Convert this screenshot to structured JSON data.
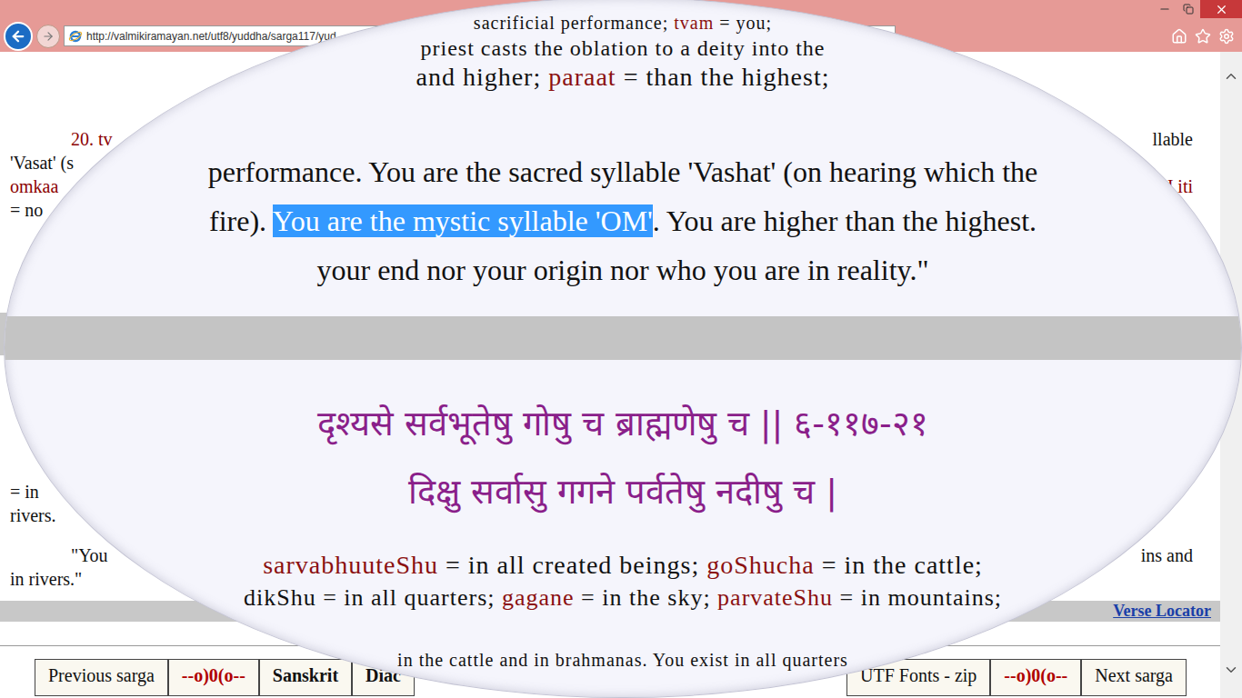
{
  "browser": {
    "url": "http://valmikiramayan.net/utf8/yuddha/sarga117/yud"
  },
  "page": {
    "upper_rows": [
      {
        "left": "20. tv",
        "left_kind": "term",
        "right": "llable",
        "right_kind": "plain",
        "paragraph_start": true
      },
      {
        "left": "'Vasat' (s",
        "left_kind": "plain",
        "right": "",
        "right_kind": "plain",
        "paragraph_start": false
      },
      {
        "left": "omkaa",
        "left_kind": "term",
        "right": "H iti",
        "right_kind": "term",
        "paragraph_start": false
      },
      {
        "left": "= no",
        "left_kind": "plain",
        "right": "",
        "right_kind": "plain",
        "paragraph_start": false
      }
    ],
    "lower_gloss_rows": [
      {
        "left": "= in",
        "left_kind": "plain",
        "right": "",
        "right_kind": "plain",
        "paragraph_start": false
      },
      {
        "left": "rivers.",
        "left_kind": "plain",
        "right": "",
        "right_kind": "plain",
        "paragraph_start": false
      }
    ],
    "lower_translation_rows": [
      {
        "left": "\"You",
        "left_kind": "plain",
        "right": "ins and",
        "right_kind": "plain",
        "paragraph_start": true
      },
      {
        "left": "in rivers.\"",
        "left_kind": "plain",
        "right": "",
        "right_kind": "plain",
        "paragraph_start": false
      }
    ],
    "verse_locator": "Verse Locator",
    "nav_left": [
      {
        "label": "Previous sarga",
        "kind": "link"
      },
      {
        "label": "--o)0(o--",
        "kind": "ornament"
      },
      {
        "label": "Sanskrit",
        "kind": "emphasis"
      },
      {
        "label": "Diac",
        "kind": "emphasis"
      }
    ],
    "nav_right": [
      {
        "label": "UTF Fonts - zip",
        "kind": "link"
      },
      {
        "label": "--o)0(o--",
        "kind": "ornament"
      },
      {
        "label": "Next sarga",
        "kind": "link"
      }
    ]
  },
  "magnifier": {
    "top": [
      [
        {
          "text": "sacrificial performance; ",
          "kind": "plain"
        },
        {
          "text": "tvam",
          "kind": "term"
        },
        {
          "text": " = you;",
          "kind": "plain"
        }
      ],
      [
        {
          "text": "priest casts the oblation to a deity into the",
          "kind": "plain"
        }
      ],
      [
        {
          "text": "and higher; ",
          "kind": "plain"
        },
        {
          "text": "paraat",
          "kind": "term"
        },
        {
          "text": " = than the highest;",
          "kind": "plain"
        }
      ]
    ],
    "translation": [
      [
        {
          "text": "performance. You are the sacred syllable 'Vashat' (on hearing which the",
          "kind": "plain"
        }
      ],
      [
        {
          "text": "fire). ",
          "kind": "plain"
        },
        {
          "text": "You are the mystic syllable 'OM'",
          "kind": "highlight"
        },
        {
          "text": ". You are higher than the highest.",
          "kind": "plain"
        }
      ],
      [
        {
          "text": "your end nor your origin nor who you are in reality.\"",
          "kind": "plain"
        }
      ]
    ],
    "verse": [
      "दृश्यसे सर्वभूतेषु गोषु च ब्राह्मणेषु च || ६-११७-२१",
      "दिक्षु सर्वासु गगने पर्वतेषु नदीषु च |"
    ],
    "gloss": [
      [
        {
          "text": "sarvabhuuteShu",
          "kind": "term"
        },
        {
          "text": " = in all created beings; ",
          "kind": "plain"
        },
        {
          "text": "goShucha",
          "kind": "term"
        },
        {
          "text": " = in the cattle;",
          "kind": "plain"
        }
      ],
      [
        {
          "text": "dikShu = in all quarters; ",
          "kind": "plain"
        },
        {
          "text": "gagane",
          "kind": "term"
        },
        {
          "text": " = in the sky; ",
          "kind": "plain"
        },
        {
          "text": "parvateShu",
          "kind": "term"
        },
        {
          "text": " = in mountains;",
          "kind": "plain"
        }
      ]
    ],
    "bottom": [
      [
        {
          "text": "in the cattle and in brahmanas. You exist in all quarters",
          "kind": "plain"
        }
      ]
    ]
  }
}
